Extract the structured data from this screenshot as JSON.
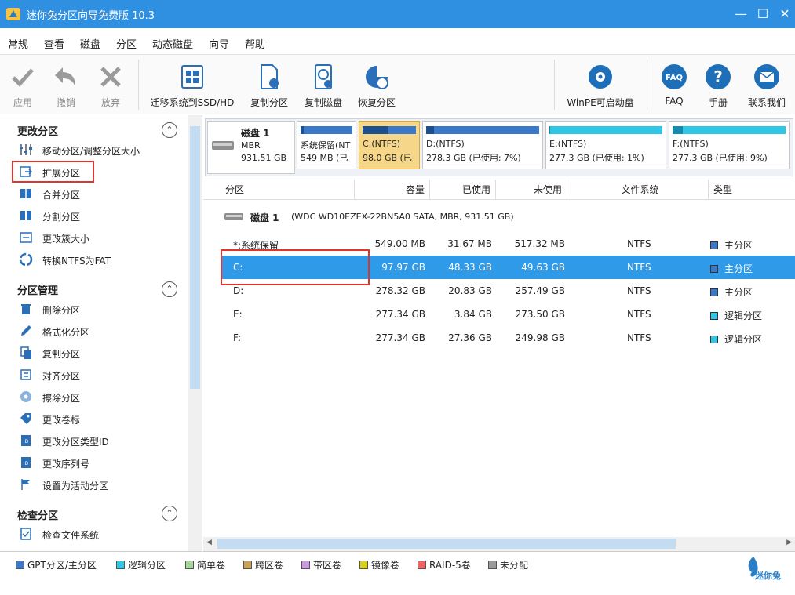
{
  "window": {
    "title": "迷你兔分区向导免费版 10.3"
  },
  "menu": [
    "常规",
    "查看",
    "磁盘",
    "分区",
    "动态磁盘",
    "向导",
    "帮助"
  ],
  "toolbar": {
    "apply": "应用",
    "undo": "撤销",
    "discard": "放弃",
    "migrate": "迁移系统到SSD/HD",
    "copy_partition": "复制分区",
    "copy_disk": "复制磁盘",
    "recover_partition": "恢复分区",
    "winpe": "WinPE可启动盘",
    "faq": "FAQ",
    "manual": "手册",
    "contact": "联系我们"
  },
  "sidebar": {
    "sections": [
      {
        "title": "更改分区",
        "items": [
          "移动分区/调整分区大小",
          "扩展分区",
          "合并分区",
          "分割分区",
          "更改簇大小",
          "转换NTFS为FAT"
        ]
      },
      {
        "title": "分区管理",
        "items": [
          "删除分区",
          "格式化分区",
          "复制分区",
          "对齐分区",
          "擦除分区",
          "更改卷标",
          "更改分区类型ID",
          "更改序列号",
          "设置为活动分区"
        ]
      },
      {
        "title": "检查分区",
        "items": [
          "检查文件系统"
        ]
      }
    ]
  },
  "diskmap": {
    "disk": {
      "name": "磁盘 1",
      "style": "MBR",
      "size": "931.51 GB"
    },
    "partitions": [
      {
        "line1": "系统保留(NT",
        "line2": "549 MB (已",
        "used": 0.06,
        "color": "#3a78c9"
      },
      {
        "line1": "C:(NTFS)",
        "line2": "98.0 GB (已",
        "used": 0.49,
        "color": "#3a78c9"
      },
      {
        "line1": "D:(NTFS)",
        "line2": "278.3 GB (已使用: 7%)",
        "used": 0.07,
        "color": "#3a78c9"
      },
      {
        "line1": "E:(NTFS)",
        "line2": "277.3 GB (已使用: 1%)",
        "used": 0.01,
        "color": "#2ec7e6"
      },
      {
        "line1": "F:(NTFS)",
        "line2": "277.3 GB (已使用: 9%)",
        "used": 0.09,
        "color": "#2ec7e6"
      }
    ]
  },
  "table": {
    "headers": [
      "分区",
      "容量",
      "已使用",
      "未使用",
      "文件系统",
      "类型"
    ],
    "disk_row": {
      "name": "磁盘 1",
      "desc": "(WDC WD10EZEX-22BN5A0 SATA, MBR, 931.51 GB)"
    },
    "rows": [
      {
        "partition": "*:系统保留",
        "capacity": "549.00 MB",
        "used": "31.67 MB",
        "unused": "517.32 MB",
        "fs": "NTFS",
        "type": "主分区",
        "type_color": "#3a78c9"
      },
      {
        "partition": "C:",
        "capacity": "97.97 GB",
        "used": "48.33 GB",
        "unused": "49.63 GB",
        "fs": "NTFS",
        "type": "主分区",
        "type_color": "#3a78c9"
      },
      {
        "partition": "D:",
        "capacity": "278.32 GB",
        "used": "20.83 GB",
        "unused": "257.49 GB",
        "fs": "NTFS",
        "type": "主分区",
        "type_color": "#3a78c9"
      },
      {
        "partition": "E:",
        "capacity": "277.34 GB",
        "used": "3.84 GB",
        "unused": "273.50 GB",
        "fs": "NTFS",
        "type": "逻辑分区",
        "type_color": "#2ec7e6"
      },
      {
        "partition": "F:",
        "capacity": "277.34 GB",
        "used": "27.36 GB",
        "unused": "249.98 GB",
        "fs": "NTFS",
        "type": "逻辑分区",
        "type_color": "#2ec7e6"
      }
    ]
  },
  "legend": [
    {
      "label": "GPT分区/主分区",
      "color": "#3a78c9"
    },
    {
      "label": "逻辑分区",
      "color": "#2ec7e6"
    },
    {
      "label": "简单卷",
      "color": "#a6d79a"
    },
    {
      "label": "跨区卷",
      "color": "#c9a25a"
    },
    {
      "label": "带区卷",
      "color": "#c99ae0"
    },
    {
      "label": "镜像卷",
      "color": "#d6d21b"
    },
    {
      "label": "RAID-5卷",
      "color": "#f06464"
    },
    {
      "label": "未分配",
      "color": "#9b9b9b"
    }
  ],
  "brand": "迷你兔"
}
